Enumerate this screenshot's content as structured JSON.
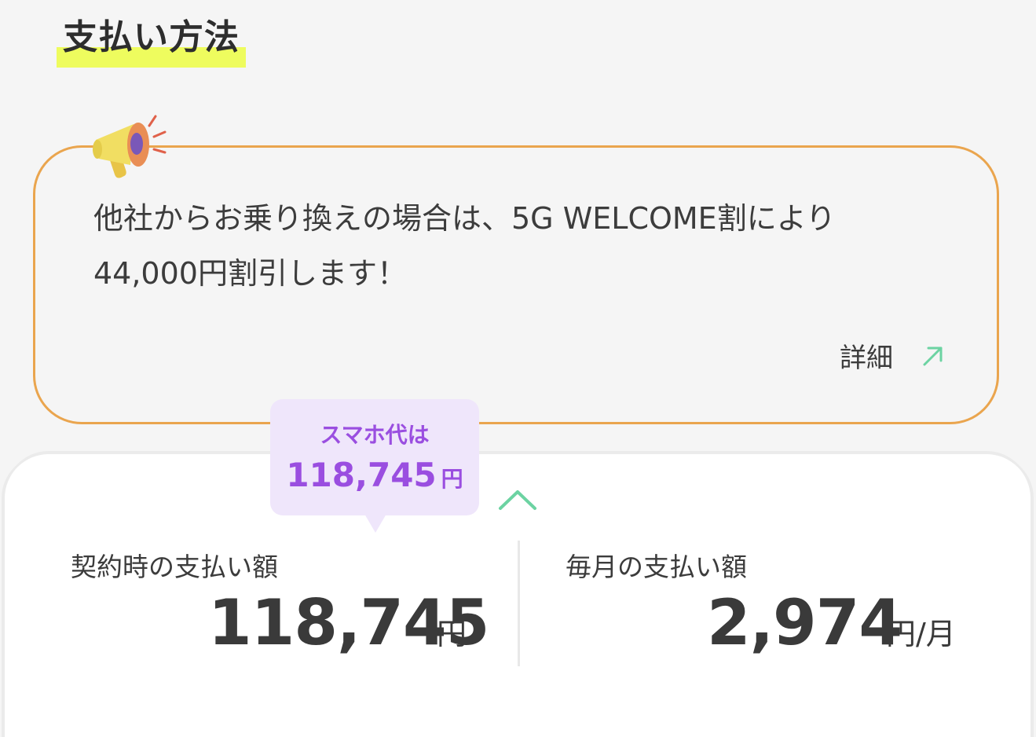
{
  "section": {
    "title": "支払い方法"
  },
  "promo": {
    "icon": "megaphone-icon",
    "line1": "他社からお乗り換えの場合は、5G WELCOME割により",
    "line2": "44,000円割引します！",
    "detail_label": "詳細",
    "detail_icon": "arrow-up-right-icon"
  },
  "bubble": {
    "label": "スマホ代は",
    "amount": "118,745",
    "unit": "円"
  },
  "summary": {
    "toggle_icon": "chevron-up-icon",
    "upfront": {
      "label": "契約時の支払い額",
      "amount": "118,745",
      "unit": "円"
    },
    "monthly": {
      "label": "毎月の支払い額",
      "amount": "2,974",
      "unit": "円/月"
    }
  },
  "colors": {
    "highlight": "#eefc5e",
    "promo_border": "#eaa54e",
    "bubble_bg": "#efe6fb",
    "bubble_text": "#9a4ee0",
    "accent_green": "#6cd3a2"
  }
}
